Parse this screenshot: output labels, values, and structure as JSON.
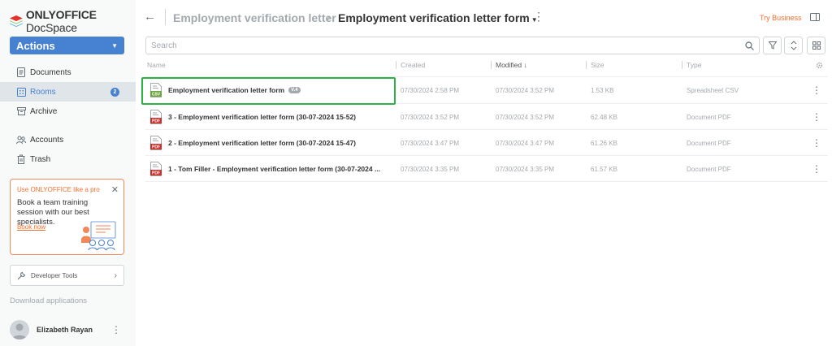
{
  "app": {
    "logo_bold": "ONLYOFFICE",
    "logo_light": " DocSpace"
  },
  "sidebar": {
    "actions_label": "Actions",
    "items": [
      {
        "label": "Documents",
        "icon": "document-icon"
      },
      {
        "label": "Rooms",
        "icon": "rooms-icon",
        "badge": "2",
        "active": true
      },
      {
        "label": "Archive",
        "icon": "archive-icon"
      },
      {
        "label": "Accounts",
        "icon": "accounts-icon"
      },
      {
        "label": "Trash",
        "icon": "trash-icon"
      }
    ],
    "promo": {
      "title": "Use ONLYOFFICE like a pro",
      "text": "Book a team training session with our best specialists.",
      "link": "Book now"
    },
    "developer_tools": "Developer Tools",
    "download_apps": "Download applications",
    "user_name": "Elizabeth Rayan"
  },
  "header": {
    "breadcrumb_parent": "Employment verification letter",
    "breadcrumb_current": "Employment verification letter form",
    "try_business": "Try Business"
  },
  "search": {
    "placeholder": "Search"
  },
  "table": {
    "columns": {
      "name": "Name",
      "created": "Created",
      "modified": "Modified ↓",
      "size": "Size",
      "type": "Type"
    },
    "rows": [
      {
        "name": "Employment verification letter form",
        "version": "V.4",
        "icon": "csv-file-icon",
        "created": "07/30/2024 2:58 PM",
        "modified": "07/30/2024 3:52 PM",
        "size": "1.53 KB",
        "type": "Spreadsheet CSV"
      },
      {
        "name": "3 - Employment verification letter form (30-07-2024 15-52)",
        "icon": "pdf-file-icon",
        "created": "07/30/2024 3:52 PM",
        "modified": "07/30/2024 3:52 PM",
        "size": "62.48 KB",
        "type": "Document PDF"
      },
      {
        "name": "2 - Employment verification letter form (30-07-2024 15-47)",
        "icon": "pdf-file-icon",
        "created": "07/30/2024 3:47 PM",
        "modified": "07/30/2024 3:47 PM",
        "size": "61.26 KB",
        "type": "Document PDF"
      },
      {
        "name": "1 - Tom Filler - Employment verification letter form (30-07-2024 ...",
        "icon": "pdf-file-icon",
        "created": "07/30/2024 3:35 PM",
        "modified": "07/30/2024 3:35 PM",
        "size": "61.57 KB",
        "type": "Document PDF"
      }
    ]
  },
  "colors": {
    "accent": "#4781d1",
    "promo": "#f26e2d",
    "highlight": "#2db24a",
    "csv": "#6fa53f",
    "pdf": "#c9302c"
  }
}
